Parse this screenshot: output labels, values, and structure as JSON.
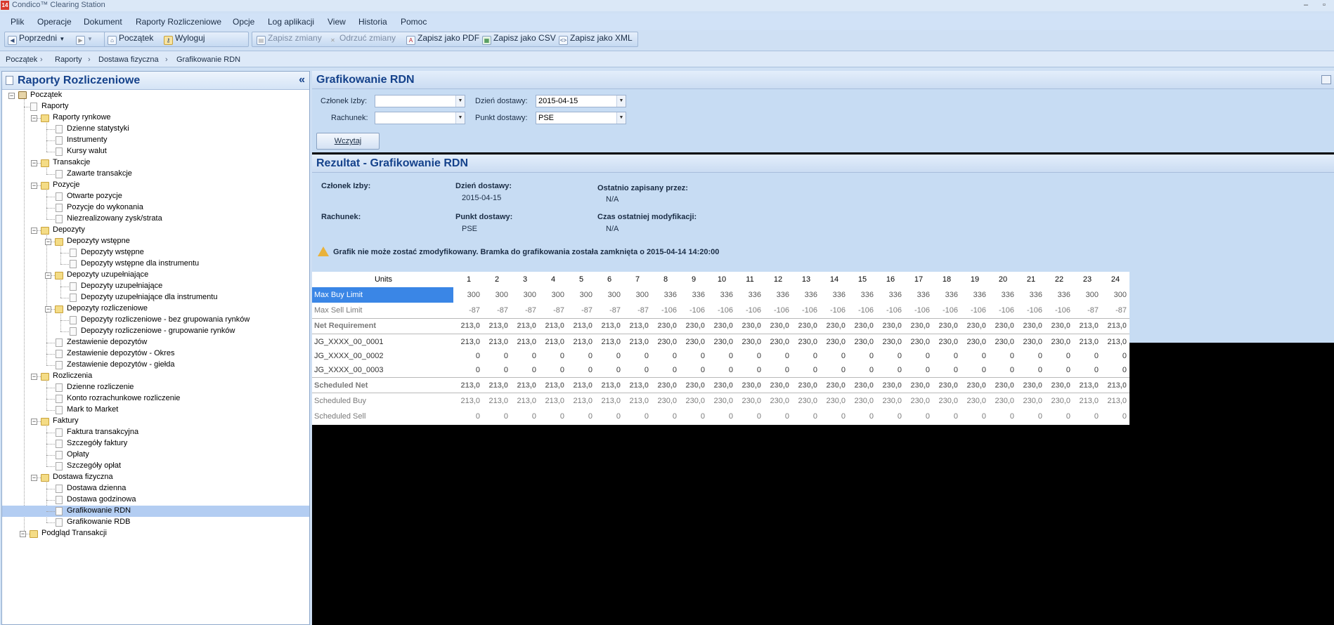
{
  "window": {
    "title": "Condico™ Clearing Station",
    "app_icon": "14"
  },
  "menu": [
    "Plik",
    "Operacje",
    "Dokument",
    "Raporty Rozliczeniowe",
    "Opcje",
    "Log aplikacji",
    "View",
    "Historia",
    "Pomoc"
  ],
  "toolbar": {
    "back": "Poprzedni",
    "home": "Początek",
    "logout": "Wyloguj",
    "save": "Zapisz zmiany",
    "discard": "Odrzuć zmiany",
    "pdf": "Zapisz jako PDF",
    "csv": "Zapisz jako CSV",
    "xml": "Zapisz jako XML"
  },
  "breadcrumb": [
    "Początek",
    "Raporty",
    "Dostawa fizyczna",
    "Grafikowanie RDN"
  ],
  "left": {
    "title": "Raporty Rozliczeniowe",
    "collapse": "«",
    "tree": [
      {
        "label": "Początek",
        "level": 0,
        "type": "home"
      },
      {
        "label": "Raporty",
        "level": 1,
        "type": "doc"
      },
      {
        "label": "Raporty rynkowe",
        "level": 2,
        "type": "folder"
      },
      {
        "label": "Dzienne statystyki",
        "level": 3,
        "type": "doc"
      },
      {
        "label": "Instrumenty",
        "level": 3,
        "type": "doc"
      },
      {
        "label": "Kursy walut",
        "level": 3,
        "type": "doc"
      },
      {
        "label": "Transakcje",
        "level": 2,
        "type": "folder"
      },
      {
        "label": "Zawarte transakcje",
        "level": 3,
        "type": "doc"
      },
      {
        "label": "Pozycje",
        "level": 2,
        "type": "folder"
      },
      {
        "label": "Otwarte pozycje",
        "level": 3,
        "type": "doc"
      },
      {
        "label": "Pozycje do wykonania",
        "level": 3,
        "type": "doc"
      },
      {
        "label": "Niezrealizowany zysk/strata",
        "level": 3,
        "type": "doc"
      },
      {
        "label": "Depozyty",
        "level": 2,
        "type": "folder"
      },
      {
        "label": "Depozyty wstępne",
        "level": 3,
        "type": "folder"
      },
      {
        "label": "Depozyty wstępne",
        "level": 4,
        "type": "doc"
      },
      {
        "label": "Depozyty wstępne dla instrumentu",
        "level": 4,
        "type": "doc"
      },
      {
        "label": "Depozyty uzupełniające",
        "level": 3,
        "type": "folder"
      },
      {
        "label": "Depozyty uzupełniające",
        "level": 4,
        "type": "doc"
      },
      {
        "label": "Depozyty uzupełniające dla instrumentu",
        "level": 4,
        "type": "doc"
      },
      {
        "label": "Depozyty rozliczeniowe",
        "level": 3,
        "type": "folder"
      },
      {
        "label": "Depozyty rozliczeniowe - bez grupowania rynków",
        "level": 4,
        "type": "doc"
      },
      {
        "label": "Depozyty rozliczeniowe - grupowanie rynków",
        "level": 4,
        "type": "doc"
      },
      {
        "label": "Zestawienie depozytów",
        "level": 3,
        "type": "doc"
      },
      {
        "label": "Zestawienie depozytów - Okres",
        "level": 3,
        "type": "doc"
      },
      {
        "label": "Zestawienie depozytów - giełda",
        "level": 3,
        "type": "doc"
      },
      {
        "label": "Rozliczenia",
        "level": 2,
        "type": "folder"
      },
      {
        "label": "Dzienne rozliczenie",
        "level": 3,
        "type": "doc"
      },
      {
        "label": "Konto rozrachunkowe rozliczenie",
        "level": 3,
        "type": "doc"
      },
      {
        "label": "Mark to Market",
        "level": 3,
        "type": "doc"
      },
      {
        "label": "Faktury",
        "level": 2,
        "type": "folder"
      },
      {
        "label": "Faktura transakcyjna",
        "level": 3,
        "type": "doc"
      },
      {
        "label": "Szczegóły faktury",
        "level": 3,
        "type": "doc"
      },
      {
        "label": "Opłaty",
        "level": 3,
        "type": "doc"
      },
      {
        "label": "Szczegóły opłat",
        "level": 3,
        "type": "doc"
      },
      {
        "label": "Dostawa fizyczna",
        "level": 2,
        "type": "folder"
      },
      {
        "label": "Dostawa dzienna",
        "level": 3,
        "type": "doc"
      },
      {
        "label": "Dostawa godzinowa",
        "level": 3,
        "type": "doc"
      },
      {
        "label": "Grafikowanie RDN",
        "level": 3,
        "type": "doc",
        "selected": true
      },
      {
        "label": "Grafikowanie RDB",
        "level": 3,
        "type": "doc"
      },
      {
        "label": "Podgląd Transakcji",
        "level": 1,
        "type": "folder"
      }
    ]
  },
  "filter": {
    "title": "Grafikowanie RDN",
    "member_label": "Członek Izby:",
    "member_value": "",
    "account_label": "Rachunek:",
    "account_value": "",
    "day_label": "Dzień dostawy:",
    "day_value": "2015-04-15",
    "point_label": "Punkt dostawy:",
    "point_value": "PSE",
    "load_button": "Wczytaj"
  },
  "result": {
    "title": "Rezultat - Grafikowanie RDN",
    "member_label": "Członek Izby:",
    "member_value": "",
    "day_label": "Dzień dostawy:",
    "day_value": "2015-04-15",
    "saved_by_label": "Ostatnio zapisany przez:",
    "saved_by_value": "N/A",
    "account_label": "Rachunek:",
    "account_value": "",
    "point_label": "Punkt dostawy:",
    "point_value": "PSE",
    "modified_label": "Czas ostatniej modyfikacji:",
    "modified_value": "N/A",
    "warning": "Grafik nie może zostać zmodyfikowany. Bramka do grafikowania została zamknięta o 2015-04-14 14:20:00"
  },
  "grid": {
    "units_header": "Units",
    "hours": [
      "1",
      "2",
      "3",
      "4",
      "5",
      "6",
      "7",
      "8",
      "9",
      "10",
      "11",
      "12",
      "13",
      "14",
      "15",
      "16",
      "17",
      "18",
      "19",
      "20",
      "21",
      "22",
      "23",
      "24"
    ],
    "rows": [
      {
        "name": "Max Buy Limit",
        "style": "selected",
        "values": [
          "300",
          "300",
          "300",
          "300",
          "300",
          "300",
          "300",
          "336",
          "336",
          "336",
          "336",
          "336",
          "336",
          "336",
          "336",
          "336",
          "336",
          "336",
          "336",
          "336",
          "336",
          "336",
          "300",
          "300"
        ]
      },
      {
        "name": "Max Sell Limit",
        "style": "grey",
        "values": [
          "-87",
          "-87",
          "-87",
          "-87",
          "-87",
          "-87",
          "-87",
          "-106",
          "-106",
          "-106",
          "-106",
          "-106",
          "-106",
          "-106",
          "-106",
          "-106",
          "-106",
          "-106",
          "-106",
          "-106",
          "-106",
          "-106",
          "-87",
          "-87"
        ]
      },
      {
        "name": "Net Requirement",
        "style": "boldgrey",
        "values": [
          "213,0",
          "213,0",
          "213,0",
          "213,0",
          "213,0",
          "213,0",
          "213,0",
          "230,0",
          "230,0",
          "230,0",
          "230,0",
          "230,0",
          "230,0",
          "230,0",
          "230,0",
          "230,0",
          "230,0",
          "230,0",
          "230,0",
          "230,0",
          "230,0",
          "230,0",
          "213,0",
          "213,0"
        ]
      },
      {
        "name": "JG_XXXX_00_0001",
        "style": "dark",
        "values": [
          "213,0",
          "213,0",
          "213,0",
          "213,0",
          "213,0",
          "213,0",
          "213,0",
          "230,0",
          "230,0",
          "230,0",
          "230,0",
          "230,0",
          "230,0",
          "230,0",
          "230,0",
          "230,0",
          "230,0",
          "230,0",
          "230,0",
          "230,0",
          "230,0",
          "230,0",
          "213,0",
          "213,0"
        ]
      },
      {
        "name": "JG_XXXX_00_0002",
        "style": "dark",
        "values": [
          "0",
          "0",
          "0",
          "0",
          "0",
          "0",
          "0",
          "0",
          "0",
          "0",
          "0",
          "0",
          "0",
          "0",
          "0",
          "0",
          "0",
          "0",
          "0",
          "0",
          "0",
          "0",
          "0",
          "0"
        ]
      },
      {
        "name": "JG_XXXX_00_0003",
        "style": "dark",
        "values": [
          "0",
          "0",
          "0",
          "0",
          "0",
          "0",
          "0",
          "0",
          "0",
          "0",
          "0",
          "0",
          "0",
          "0",
          "0",
          "0",
          "0",
          "0",
          "0",
          "0",
          "0",
          "0",
          "0",
          "0"
        ]
      },
      {
        "name": "Scheduled Net",
        "style": "boldgrey",
        "values": [
          "213,0",
          "213,0",
          "213,0",
          "213,0",
          "213,0",
          "213,0",
          "213,0",
          "230,0",
          "230,0",
          "230,0",
          "230,0",
          "230,0",
          "230,0",
          "230,0",
          "230,0",
          "230,0",
          "230,0",
          "230,0",
          "230,0",
          "230,0",
          "230,0",
          "230,0",
          "213,0",
          "213,0"
        ]
      },
      {
        "name": "Scheduled Buy",
        "style": "grey",
        "values": [
          "213,0",
          "213,0",
          "213,0",
          "213,0",
          "213,0",
          "213,0",
          "213,0",
          "230,0",
          "230,0",
          "230,0",
          "230,0",
          "230,0",
          "230,0",
          "230,0",
          "230,0",
          "230,0",
          "230,0",
          "230,0",
          "230,0",
          "230,0",
          "230,0",
          "230,0",
          "213,0",
          "213,0"
        ]
      },
      {
        "name": "Scheduled Sell",
        "style": "grey",
        "values": [
          "0",
          "0",
          "0",
          "0",
          "0",
          "0",
          "0",
          "0",
          "0",
          "0",
          "0",
          "0",
          "0",
          "0",
          "0",
          "0",
          "0",
          "0",
          "0",
          "0",
          "0",
          "0",
          "0",
          "0"
        ]
      }
    ]
  }
}
